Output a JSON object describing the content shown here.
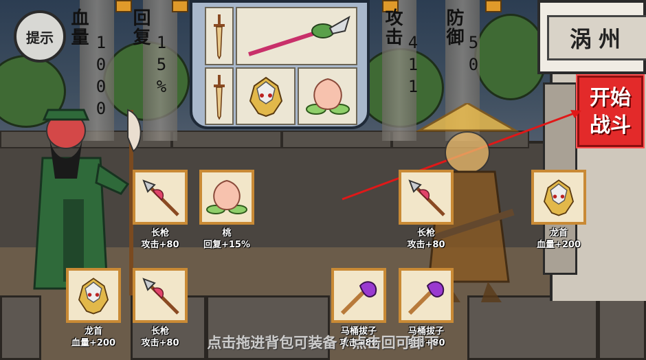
{
  "hint_button": {
    "label": "提示"
  },
  "player_stats": {
    "hp": {
      "label": "血量",
      "value": "1000"
    },
    "regen": {
      "label": "回复",
      "value": "15%"
    }
  },
  "enemy_stats": {
    "attack": {
      "label": "攻击",
      "value": "411"
    },
    "defense": {
      "label": "防御",
      "value": "50"
    }
  },
  "location_sign": {
    "text": "涡州"
  },
  "start_battle": {
    "label_line1": "开始",
    "label_line2": "战斗"
  },
  "player_items": [
    {
      "name": "长枪",
      "effect": "攻击+80",
      "icon": "spear-icon"
    },
    {
      "name": "桃",
      "effect": "回复+15%",
      "icon": "peach-icon"
    },
    {
      "name": "龙首",
      "effect": "血量+200",
      "icon": "dragon-head-icon"
    },
    {
      "name": "长枪",
      "effect": "攻击+80",
      "icon": "spear-icon"
    }
  ],
  "enemy_items": [
    {
      "name": "长枪",
      "effect": "攻击+80",
      "icon": "spear-icon"
    },
    {
      "name": "龙首",
      "effect": "血量+200",
      "icon": "dragon-head-icon"
    },
    {
      "name": "马桶拔子",
      "effect": "攻击+80",
      "icon": "plunger-icon"
    },
    {
      "name": "马桶拔子",
      "effect": "攻击+80",
      "icon": "plunger-icon"
    }
  ],
  "bag_items": [
    "dagger-icon",
    "dragon-blade-icon",
    "dagger-icon",
    "dragon-head-icon",
    "peach-icon"
  ],
  "footer_hint": "点击拖进背包可装备 / 点击回可卸下",
  "colors": {
    "start_button": "#e32a2a",
    "slot_border": "#c98a35",
    "bag_bg": "#a9b8cc"
  }
}
